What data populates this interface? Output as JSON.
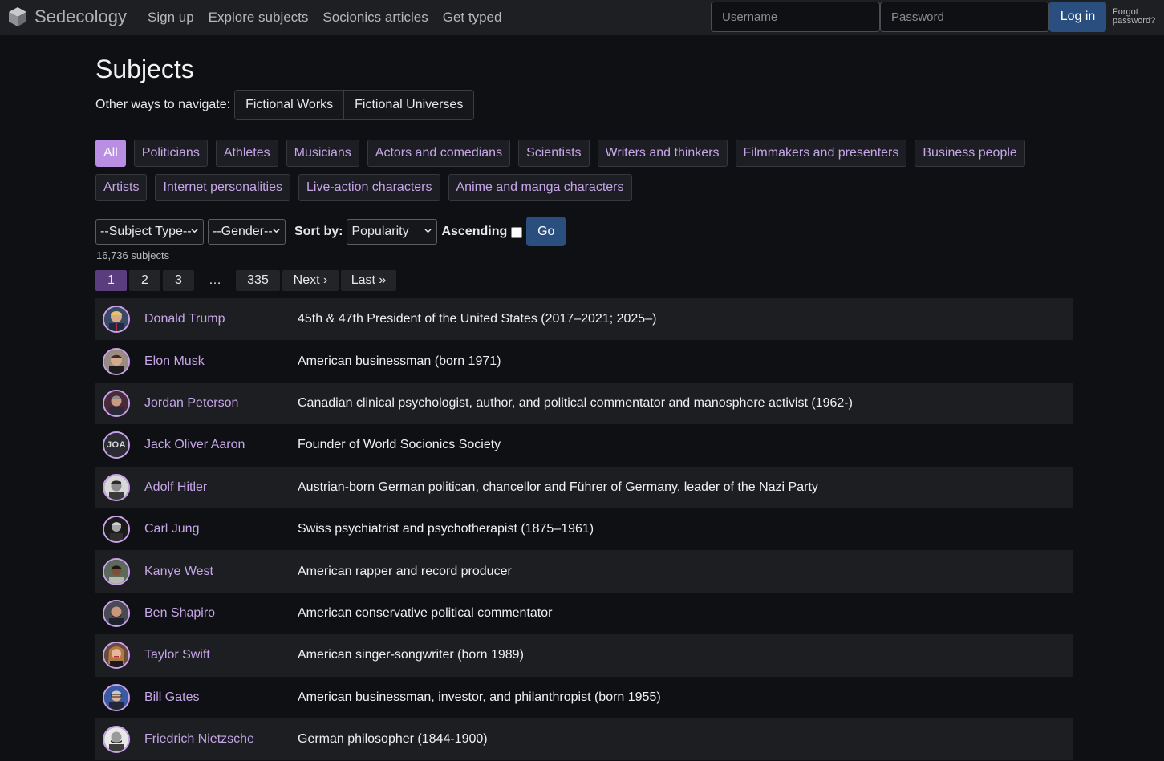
{
  "navbar": {
    "brand": "Sedecology",
    "links": [
      "Sign up",
      "Explore subjects",
      "Socionics articles",
      "Get typed"
    ],
    "username_placeholder": "Username",
    "password_placeholder": "Password",
    "login_label": "Log in",
    "forgot_line1": "Forgot",
    "forgot_line2": "password?"
  },
  "page": {
    "title": "Subjects",
    "other_ways_label": "Other ways to navigate:",
    "other_ways": [
      "Fictional Works",
      "Fictional Universes"
    ]
  },
  "categories": [
    "All",
    "Politicians",
    "Athletes",
    "Musicians",
    "Actors and comedians",
    "Scientists",
    "Writers and thinkers",
    "Filmmakers and presenters",
    "Business people",
    "Artists",
    "Internet personalities",
    "Live-action characters",
    "Anime and manga characters"
  ],
  "active_category": "All",
  "filters": {
    "subject_type": "--Subject Type--",
    "gender": "--Gender--",
    "sort_by_label": "Sort by:",
    "sort_value": "Popularity",
    "ascending_label": "Ascending",
    "ascending_checked": false,
    "go_label": "Go"
  },
  "subject_count": "16,736 subjects",
  "pagination": {
    "pages": [
      "1",
      "2",
      "3",
      "…",
      "335",
      "Next ›",
      "Last »"
    ],
    "current": "1"
  },
  "subjects": [
    {
      "name": "Donald Trump",
      "description": "45th & 47th President of the United States (2017–2021; 2025–)",
      "avatar": "portrait"
    },
    {
      "name": "Elon Musk",
      "description": "American businessman (born 1971)",
      "avatar": "portrait"
    },
    {
      "name": "Jordan Peterson",
      "description": "Canadian clinical psychologist, author, and political commentator and manosphere activist (1962-)",
      "avatar": "portrait"
    },
    {
      "name": "Jack Oliver Aaron",
      "description": "Founder of World Socionics Society",
      "avatar": "initials",
      "initials": "JOA"
    },
    {
      "name": "Adolf Hitler",
      "description": "Austrian-born German politican, chancellor and Führer of Germany, leader of the Nazi Party",
      "avatar": "portrait"
    },
    {
      "name": "Carl Jung",
      "description": "Swiss psychiatrist and psychotherapist (1875–1961)",
      "avatar": "portrait"
    },
    {
      "name": "Kanye West",
      "description": "American rapper and record producer",
      "avatar": "portrait"
    },
    {
      "name": "Ben Shapiro",
      "description": "American conservative political commentator",
      "avatar": "portrait"
    },
    {
      "name": "Taylor Swift",
      "description": "American singer-songwriter (born 1989)",
      "avatar": "portrait"
    },
    {
      "name": "Bill Gates",
      "description": "American businessman, investor, and philanthropist (born 1955)",
      "avatar": "portrait"
    },
    {
      "name": "Friedrich Nietzsche",
      "description": "German philosopher (1844-1900)",
      "avatar": "portrait"
    }
  ],
  "colors": {
    "background": "#0e1014",
    "navbar": "#1d1f23",
    "link_purple": "#c7a6e8",
    "active_category": "#b98ee3",
    "button_blue": "#2a4f7f",
    "active_page": "#5a3d7e"
  }
}
